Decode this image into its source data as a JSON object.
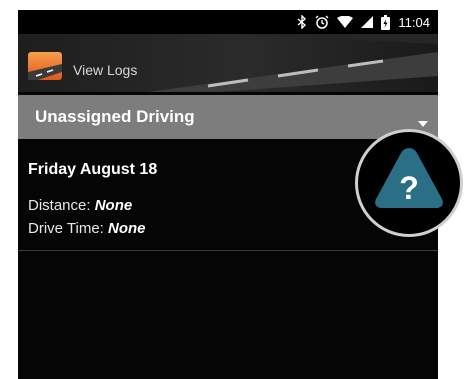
{
  "status_bar": {
    "time": "11:04",
    "icons": [
      "bluetooth-icon",
      "alarm-icon",
      "wifi-icon",
      "signal-icon",
      "battery-icon"
    ]
  },
  "app_bar": {
    "title": "View Logs",
    "logo_icon": "road-logo-icon"
  },
  "dropdown": {
    "selected": "Unassigned Driving",
    "arrow_icon": "dropdown-arrow-icon"
  },
  "log_entry": {
    "date": "Friday August 18",
    "distance_label": "Distance:",
    "distance_value": "None",
    "drive_time_label": "Drive Time:",
    "drive_time_value": "None"
  },
  "help_badge": {
    "symbol": "?",
    "icon": "warning-help-icon",
    "color": "#2a6f86"
  },
  "colors": {
    "background": "#050505",
    "dropdown": "#7d7d7d",
    "accent_orange": "#f08a2c"
  }
}
